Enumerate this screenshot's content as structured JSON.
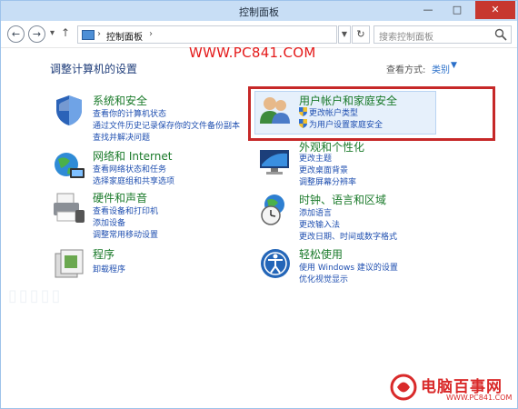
{
  "window": {
    "title": "控制面板",
    "minimize_label": "—",
    "maximize_label": "□",
    "close_label": "✕"
  },
  "nav": {
    "back_label": "←",
    "forward_label": "→",
    "up_label": "↑",
    "breadcrumb": "控制面板",
    "crumb_sep": "›",
    "refresh_label": "↻",
    "search_placeholder": "搜索控制面板"
  },
  "watermark": {
    "site_top": "WWW.PC841.COM",
    "logo_text": "电脑百事网",
    "logo_url": "WWW.PC841.COM"
  },
  "main": {
    "heading": "调整计算机的设置",
    "view_by_label": "查看方式:",
    "view_by_value": "类别"
  },
  "categories": {
    "system": {
      "title": "系统和安全",
      "links": [
        "查看你的计算机状态",
        "通过文件历史记录保存你的文件备份副本",
        "查找并解决问题"
      ]
    },
    "network": {
      "title": "网络和 Internet",
      "links": [
        "查看网络状态和任务",
        "选择家庭组和共享选项"
      ]
    },
    "hardware": {
      "title": "硬件和声音",
      "links": [
        "查看设备和打印机",
        "添加设备",
        "调整常用移动设置"
      ]
    },
    "programs": {
      "title": "程序",
      "links": [
        "卸载程序"
      ]
    },
    "user": {
      "title": "用户帐户和家庭安全",
      "links": [
        "更改帐户类型",
        "为用户设置家庭安全"
      ]
    },
    "appearance": {
      "title": "外观和个性化",
      "links": [
        "更改主题",
        "更改桌面背景",
        "调整屏幕分辨率"
      ]
    },
    "clock": {
      "title": "时钟、语言和区域",
      "links": [
        "添加语言",
        "更改输入法",
        "更改日期、时间或数字格式"
      ]
    },
    "ease": {
      "title": "轻松使用",
      "links": [
        "使用 Windows 建议的设置",
        "优化视觉显示"
      ]
    }
  },
  "colors": {
    "titlebar": "#c8def5",
    "category_title": "#1a7a2a",
    "link": "#1f4fb0",
    "highlight_border": "#c62828",
    "watermark_red": "#e41a1a"
  }
}
